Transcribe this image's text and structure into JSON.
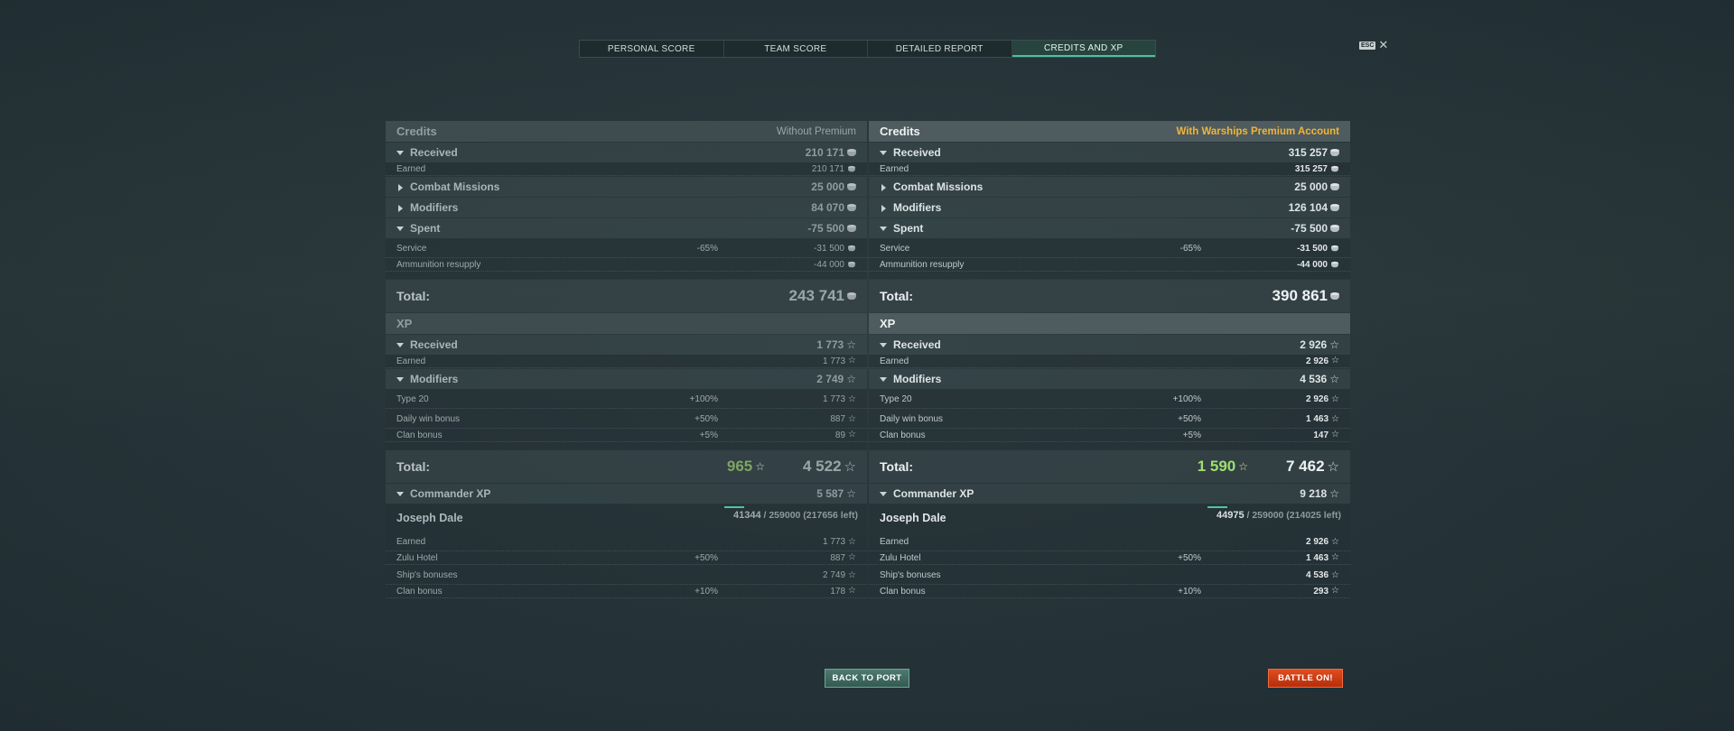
{
  "tabs": [
    "PERSONAL SCORE",
    "TEAM SCORE",
    "DETAILED REPORT",
    "CREDITS AND XP"
  ],
  "active_tab": 3,
  "close": {
    "key": "ESC",
    "icon": "close-icon"
  },
  "left": {
    "credits_header": "Credits",
    "account_label": "Without Premium",
    "received": {
      "label": "Received",
      "value": "210 171"
    },
    "earned": {
      "label": "Earned",
      "value": "210 171"
    },
    "combat_missions": {
      "label": "Combat Missions",
      "value": "25 000"
    },
    "modifiers": {
      "label": "Modifiers",
      "value": "84 070"
    },
    "spent": {
      "label": "Spent",
      "value": "-75 500"
    },
    "service": {
      "label": "Service",
      "pct": "-65%",
      "value": "-31 500"
    },
    "ammo": {
      "label": "Ammunition resupply",
      "value": "-44 000"
    },
    "credits_total": {
      "label": "Total:",
      "value": "243 741"
    },
    "xp_header": "XP",
    "xp_received": {
      "label": "Received",
      "value": "1 773"
    },
    "xp_earned": {
      "label": "Earned",
      "value": "1 773"
    },
    "xp_modifiers": {
      "label": "Modifiers",
      "value": "2 749"
    },
    "type20": {
      "label": "Type 20",
      "pct": "+100%",
      "value": "1 773"
    },
    "daily_win": {
      "label": "Daily win bonus",
      "pct": "+50%",
      "value": "887"
    },
    "clan_bonus": {
      "label": "Clan bonus",
      "pct": "+5%",
      "value": "89"
    },
    "xp_total": {
      "label": "Total:",
      "free": "965",
      "value": "4 522"
    },
    "commander_xp": {
      "label": "Commander XP",
      "value": "5 587"
    },
    "commander": {
      "name": "Joseph Dale",
      "current": "41344",
      "rest": " / 259000 (217656 left)"
    },
    "cmd_earned": {
      "label": "Earned",
      "value": "1 773"
    },
    "zulu": {
      "label": "Zulu Hotel",
      "pct": "+50%",
      "value": "887"
    },
    "ship_bonuses": {
      "label": "Ship's bonuses",
      "value": "2 749"
    },
    "cmd_clan": {
      "label": "Clan bonus",
      "pct": "+10%",
      "value": "178"
    }
  },
  "right": {
    "credits_header": "Credits",
    "account_label": "With Warships Premium Account",
    "received": {
      "label": "Received",
      "value": "315 257"
    },
    "earned": {
      "label": "Earned",
      "value": "315 257"
    },
    "combat_missions": {
      "label": "Combat Missions",
      "value": "25 000"
    },
    "modifiers": {
      "label": "Modifiers",
      "value": "126 104"
    },
    "spent": {
      "label": "Spent",
      "value": "-75 500"
    },
    "service": {
      "label": "Service",
      "pct": "-65%",
      "value": "-31 500"
    },
    "ammo": {
      "label": "Ammunition resupply",
      "value": "-44 000"
    },
    "credits_total": {
      "label": "Total:",
      "value": "390 861"
    },
    "xp_header": "XP",
    "xp_received": {
      "label": "Received",
      "value": "2 926"
    },
    "xp_earned": {
      "label": "Earned",
      "value": "2 926"
    },
    "xp_modifiers": {
      "label": "Modifiers",
      "value": "4 536"
    },
    "type20": {
      "label": "Type 20",
      "pct": "+100%",
      "value": "2 926"
    },
    "daily_win": {
      "label": "Daily win bonus",
      "pct": "+50%",
      "value": "1 463"
    },
    "clan_bonus": {
      "label": "Clan bonus",
      "pct": "+5%",
      "value": "147"
    },
    "xp_total": {
      "label": "Total:",
      "free": "1 590",
      "value": "7 462"
    },
    "commander_xp": {
      "label": "Commander XP",
      "value": "9 218"
    },
    "commander": {
      "name": "Joseph Dale",
      "current": "44975",
      "rest": " / 259000 (214025 left)"
    },
    "cmd_earned": {
      "label": "Earned",
      "value": "2 926"
    },
    "zulu": {
      "label": "Zulu Hotel",
      "pct": "+50%",
      "value": "1 463"
    },
    "ship_bonuses": {
      "label": "Ship's bonuses",
      "value": "4 536"
    },
    "cmd_clan": {
      "label": "Clan bonus",
      "pct": "+10%",
      "value": "293"
    }
  },
  "buttons": {
    "back": "BACK TO PORT",
    "battle": "BATTLE ON!"
  },
  "colors": {
    "accent": "#4fbfa0",
    "premium": "#f0b43a",
    "free_xp": "#9ee070",
    "battle": "#d63e15"
  }
}
